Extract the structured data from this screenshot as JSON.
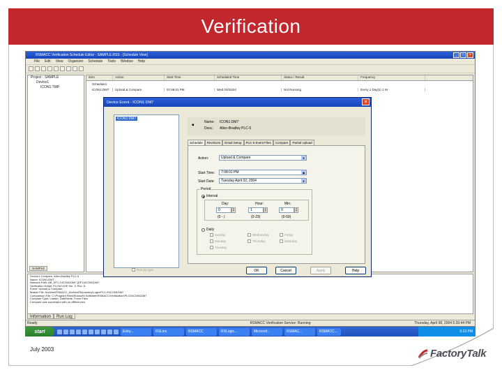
{
  "slide": {
    "title": "Verification",
    "footer_date": "July 2003",
    "logo_text": "FactoryTalk"
  },
  "app": {
    "window_title": "RSMACC Verification Schedule Editor - SAMPLE.RSS - [Schedule View]",
    "menu": [
      "File",
      "Edit",
      "View",
      "Organizer",
      "Schedule",
      "Tools",
      "Window",
      "Help"
    ],
    "tree": {
      "root": "Project - SAMPLE",
      "child1": "Device1",
      "child2": "ICON1:TMP",
      "tab": "SAMPLE"
    },
    "list": {
      "columns": [
        "Item",
        "Action",
        "Start Time",
        "Scheduled Time",
        "Status / Result",
        "Frequency"
      ],
      "schedule": "Schedule1",
      "rows": [
        [
          "ICON1:DM7",
          "Upload & Compare",
          "07:08:01 PM",
          "Wed 04/03/04",
          "Not Running",
          "Every 1 Day(s) 1 Hr"
        ]
      ]
    },
    "log": {
      "lines": [
        "Device1 Compare, Allen-Bradley PLC-5",
        "Name: ICON1:DM7",
        "Network Path: AB_DF1-1\\ICON1DM7 (DF1)\\ICON1DM7",
        "Verification Detail: PLC5C/10E Ser. C Rev. D",
        "Event: Upload & Compare",
        "Master File: Archive\\RSMACC_Archive\\Repository\\Logix\\PLC-5\\ICON1DM7",
        "Comparison File: C:\\Program Files\\Rockwell Software\\RSMACC\\Verification\\PLC5\\ICON1DM7",
        "Compare Type: Ladder, DataTable, Force Files",
        "Compare was successful with no differences."
      ],
      "tabs": [
        "Information",
        "Run Log"
      ]
    },
    "status": {
      "left": "Ready",
      "center": "RSMACC Verification Service: Running",
      "right": "Thursday, April 08, 2004    5:20:44 PM"
    }
  },
  "dialog": {
    "title": "Device Event - ICON1:DM7",
    "device_item": "ICON1:DM7",
    "name_label": "Name:",
    "name_value": "ICON1:DM7",
    "desc_label": "Desc:",
    "desc_value": "Allen-Bradley PLC-5",
    "tabs": [
      "Schedule",
      "Revisions",
      "Email Setup",
      "PLC-5 Event Files",
      "Compare",
      "Partial Upload"
    ],
    "action_label": "Action:",
    "action_value": "Upload & Compare",
    "start_time_label": "Start Time:",
    "start_time_value": "7:08:01 PM",
    "start_date_label": "Start Date:",
    "start_date_value": "Tuesday    April    02, 2004",
    "period_label": "Period",
    "interval_label": "Interval",
    "day_label": "Day:",
    "day_value": "0",
    "day_hint": "(0 - )",
    "hour_label": "Hour:",
    "hour_value": "1",
    "hour_hint": "(0-23)",
    "min_label": "Min:",
    "min_value": "0",
    "min_hint": "(0-59)",
    "daily_label": "Daily",
    "days": [
      "Sunday",
      "Wednesday",
      "Friday",
      "Monday",
      "Thursday",
      "Saturday",
      "Tuesday"
    ],
    "run_by_type": "Run by type",
    "buttons": [
      "OK",
      "Cancel",
      "Apply",
      "Help"
    ]
  },
  "taskbar": {
    "start": "start",
    "tasks": [
      "Entry...",
      "RSLinx",
      "RSMACC",
      "RSLogix...",
      "Microsof...",
      "RSMAC...",
      "RSMACC..."
    ],
    "clock": "5:23 PM"
  }
}
